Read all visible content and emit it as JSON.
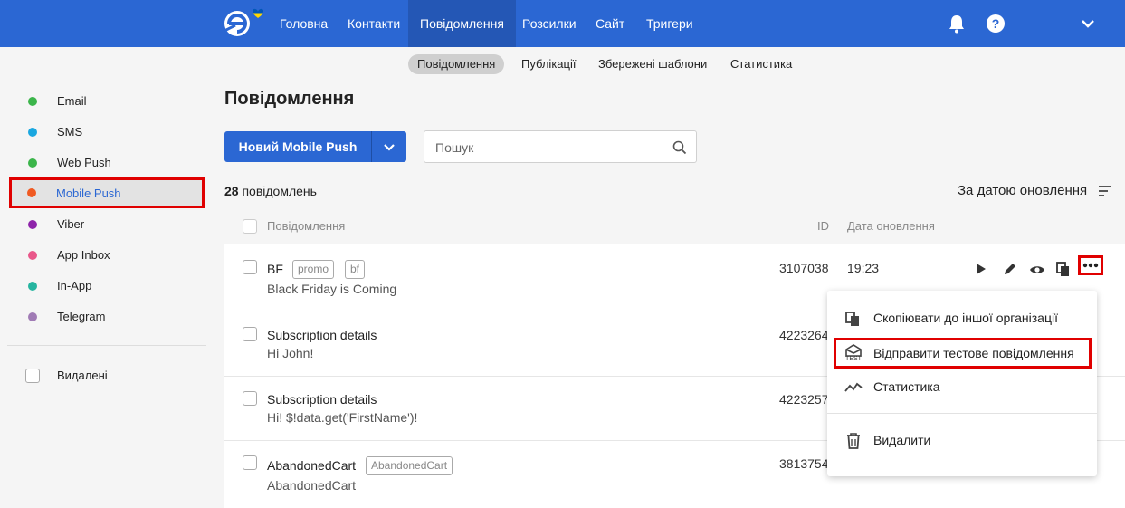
{
  "topnav": {
    "items": [
      "Головна",
      "Контакти",
      "Повідомлення",
      "Розсилки",
      "Сайт",
      "Тригери"
    ],
    "active": "Повідомлення",
    "icons": [
      "bell-icon",
      "help-icon",
      "chevron-down-icon"
    ]
  },
  "subnav": {
    "items": [
      "Повідомлення",
      "Публікації",
      "Збережені шаблони",
      "Статистика"
    ],
    "active": "Повідомлення"
  },
  "sidebar": {
    "channels": [
      {
        "label": "Email",
        "color": "#3bb54a"
      },
      {
        "label": "SMS",
        "color": "#1aa7e0"
      },
      {
        "label": "Web Push",
        "color": "#3bb54a"
      },
      {
        "label": "Mobile Push",
        "color": "#f05a22"
      },
      {
        "label": "Viber",
        "color": "#8e24aa"
      },
      {
        "label": "App Inbox",
        "color": "#e9578a"
      },
      {
        "label": "In-App",
        "color": "#26b5a0"
      },
      {
        "label": "Telegram",
        "color": "#a07bb5"
      }
    ],
    "active": "Mobile Push",
    "deleted_label": "Видалені"
  },
  "main": {
    "title": "Повідомлення",
    "new_button": "Новий Mobile Push",
    "search_placeholder": "Пошук",
    "count_number": "28",
    "count_text": "повідомлень",
    "sort_label": "За датою оновлення",
    "columns": {
      "message": "Повідомлення",
      "id": "ID",
      "date": "Дата оновлення"
    }
  },
  "rows": [
    {
      "title": "BF",
      "subtitle": "Black Friday is Coming",
      "tags": [
        "promo",
        "bf"
      ],
      "id": "3107038",
      "date": "19:23"
    },
    {
      "title": "Subscription details",
      "subtitle": "Hi John!",
      "tags": [],
      "id": "4223264",
      "date": ""
    },
    {
      "title": "Subscription details",
      "subtitle": "Hi! $!data.get('FirstName')!",
      "tags": [],
      "id": "4223257",
      "date": ""
    },
    {
      "title": "AbandonedCart",
      "subtitle": "AbandonedCart",
      "tags": [
        "AbandonedCart"
      ],
      "id": "3813754",
      "date": ""
    }
  ],
  "row_actions": [
    "play-icon",
    "edit-icon",
    "preview-icon",
    "copy-icon",
    "more-icon"
  ],
  "menu": {
    "items": [
      {
        "label": "Скопіювати до іншої організації",
        "icon": "copy-icon"
      },
      {
        "label": "Відправити тестове повідомлення",
        "icon": "test-send-icon",
        "icon_caption": "TEST"
      },
      {
        "label": "Статистика",
        "icon": "stats-icon"
      },
      {
        "label": "Видалити",
        "icon": "trash-icon"
      }
    ],
    "highlighted": "Відправити тестове повідомлення"
  },
  "colors": {
    "brand": "#2b67d3",
    "highlight": "#e00000"
  }
}
